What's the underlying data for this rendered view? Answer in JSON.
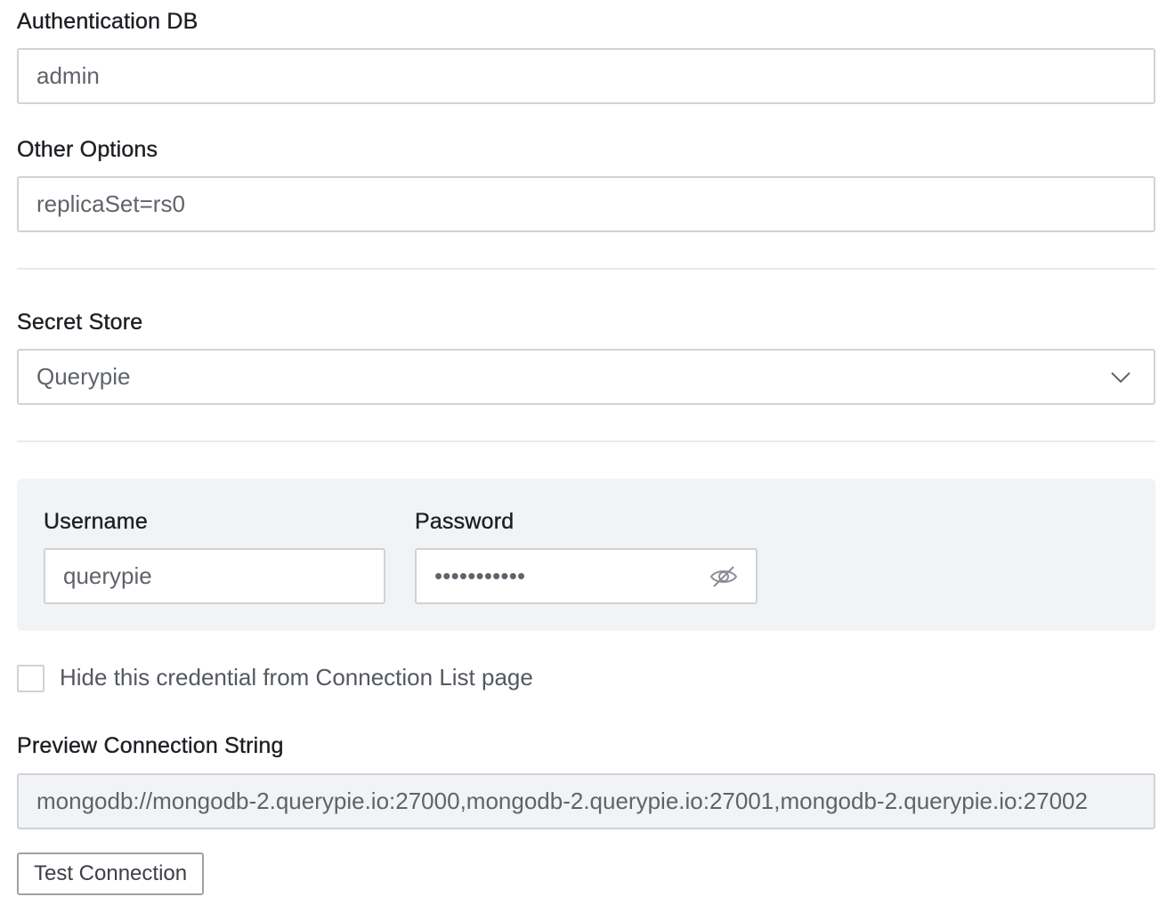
{
  "auth_db": {
    "label": "Authentication DB",
    "value": "admin"
  },
  "other_options": {
    "label": "Other Options",
    "value": "replicaSet=rs0"
  },
  "secret_store": {
    "label": "Secret Store",
    "selected": "Querypie",
    "icon": "chevron-down-icon"
  },
  "credentials": {
    "username_label": "Username",
    "username_value": "querypie",
    "password_label": "Password",
    "password_masked": "•••••••••••",
    "toggle_icon": "eye-off-icon"
  },
  "hide_credential": {
    "checked": false,
    "label": "Hide this credential from Connection List page"
  },
  "preview": {
    "label": "Preview Connection String",
    "value": "mongodb://mongodb-2.querypie.io:27000,mongodb-2.querypie.io:27001,mongodb-2.querypie.io:27002"
  },
  "actions": {
    "test_connection_label": "Test Connection"
  },
  "colors": {
    "border": "#cfd2d6",
    "panel_bg": "#f2f3f5",
    "text": "#1c1f23",
    "muted_text": "#5f636a"
  }
}
